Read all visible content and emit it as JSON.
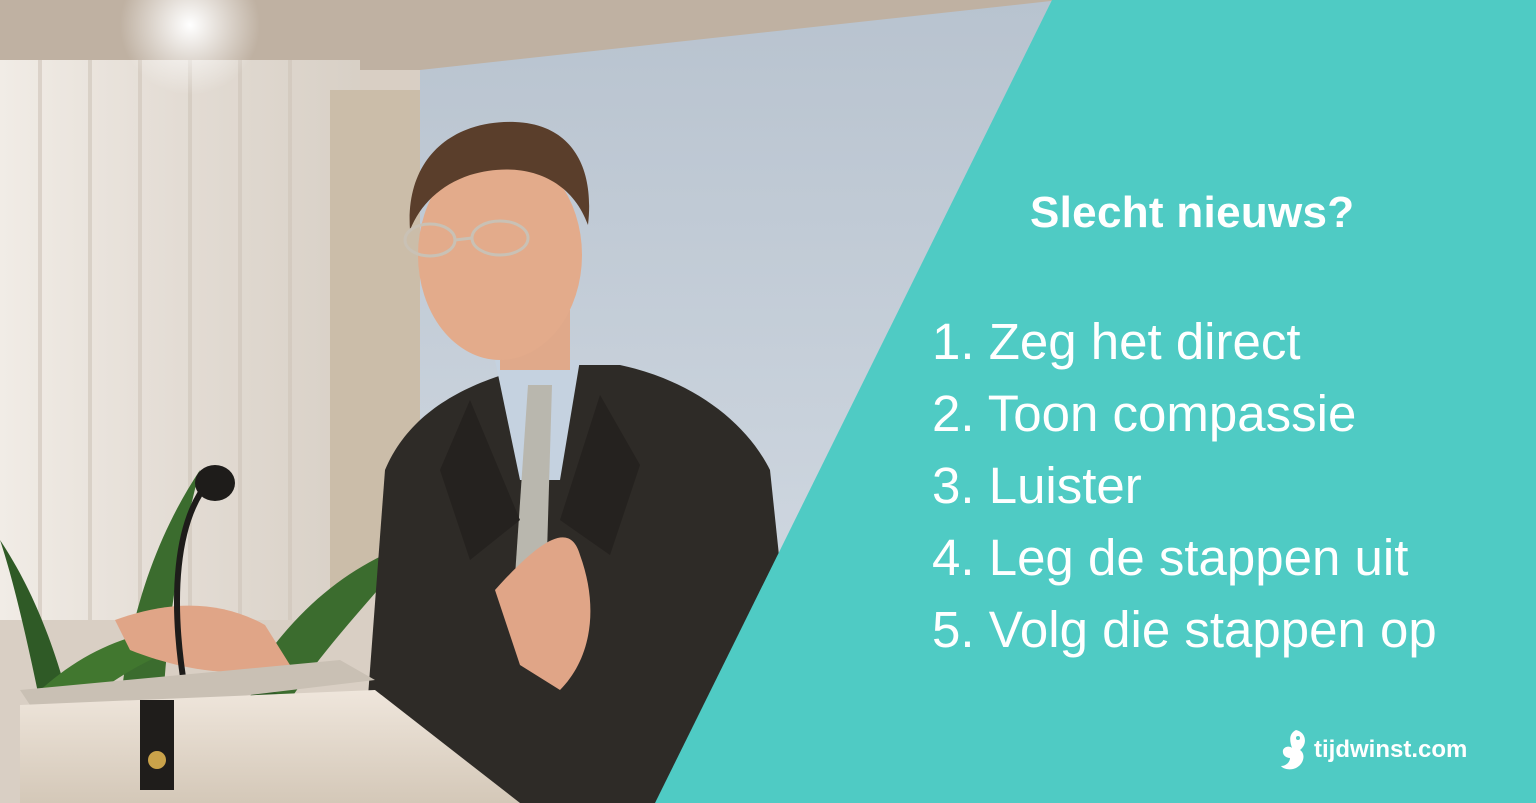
{
  "heading": "Slecht nieuws?",
  "steps": [
    "1. Zeg het direct",
    "2. Toon compassie",
    "3. Luister",
    "4. Leg de stappen uit",
    "5. Volg die stappen op"
  ],
  "brand": {
    "name": "tijdwinst.com",
    "icon": "squirrel-logo-icon"
  },
  "colors": {
    "accent": "#4fcbc4",
    "text": "#ffffff",
    "suit": "#2e2b27",
    "wall": "#c9d3dc"
  }
}
